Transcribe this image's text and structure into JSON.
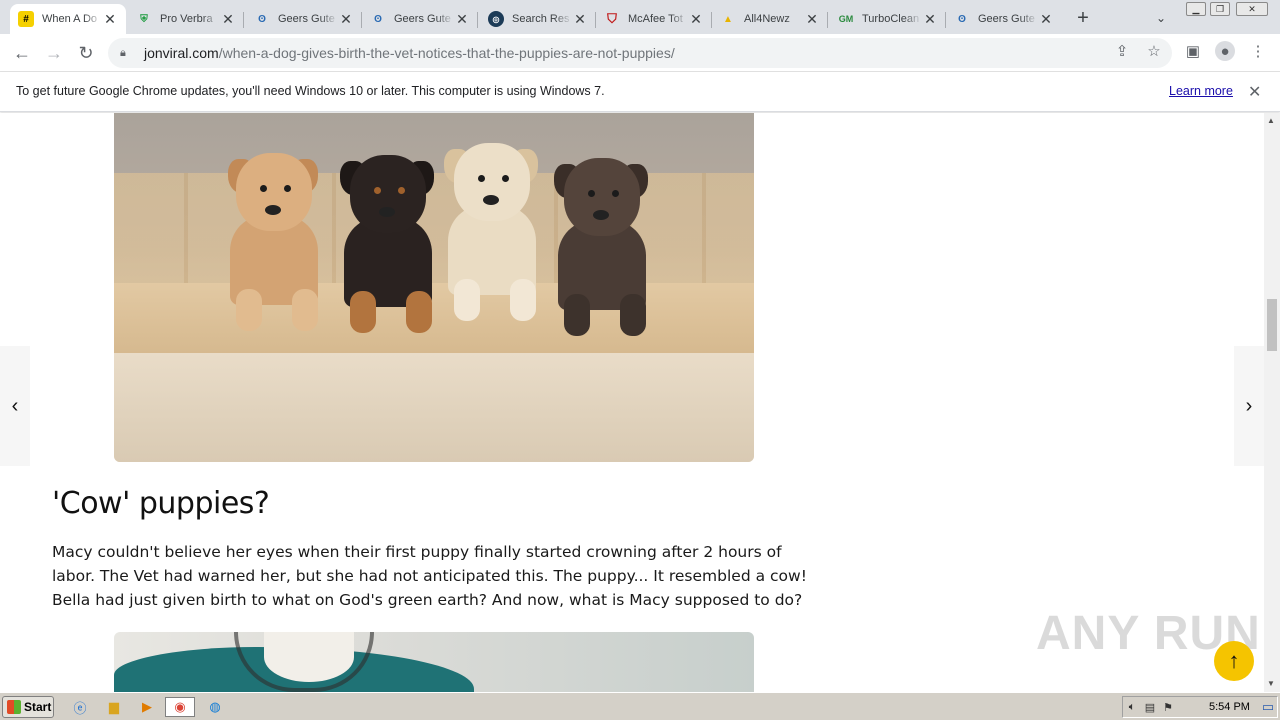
{
  "browser": {
    "tabs": [
      {
        "title": "When A Do",
        "favicon": "hash-icon",
        "active": true
      },
      {
        "title": "Pro Verbra",
        "favicon": "shield-icon",
        "active": false
      },
      {
        "title": "Geers Gute",
        "favicon": "ear-icon",
        "active": false
      },
      {
        "title": "Geers Gute",
        "favicon": "ear-icon",
        "active": false
      },
      {
        "title": "Search Res",
        "favicon": "search-icon",
        "active": false
      },
      {
        "title": "McAfee Tot",
        "favicon": "mcafee-icon",
        "active": false
      },
      {
        "title": "All4Newz",
        "favicon": "alert-icon",
        "active": false
      },
      {
        "title": "TurboClean",
        "favicon": "gm-icon",
        "active": false
      },
      {
        "title": "Geers Gute",
        "favicon": "ear-icon",
        "active": false
      }
    ],
    "new_tab": "+",
    "url_host": "jonviral.com",
    "url_path": "/when-a-dog-gives-birth-the-vet-notices-that-the-puppies-are-not-puppies/"
  },
  "infobar": {
    "message": "To get future Google Chrome updates, you'll need Windows 10 or later. This computer is using Windows 7.",
    "link": "Learn more",
    "close": "✕"
  },
  "article": {
    "heading": "'Cow' puppies?",
    "paragraph": "Macy couldn't believe her eyes when their first puppy finally started crowning after 2 hours of labor. The Vet had warned her, but she had not anticipated this. The puppy... It resembled a cow! Bella had just given birth to what on God's green earth? And now, what is Macy supposed to do?"
  },
  "overlay": {
    "watermark": "ANY RUN",
    "prev_arrow": "‹",
    "next_arrow": "›",
    "to_top": "↑"
  },
  "taskbar": {
    "start_label": "Start",
    "clock": "5:54 PM"
  },
  "colors": {
    "accent_yellow": "#f5c400",
    "link_blue": "#1a0dab"
  }
}
